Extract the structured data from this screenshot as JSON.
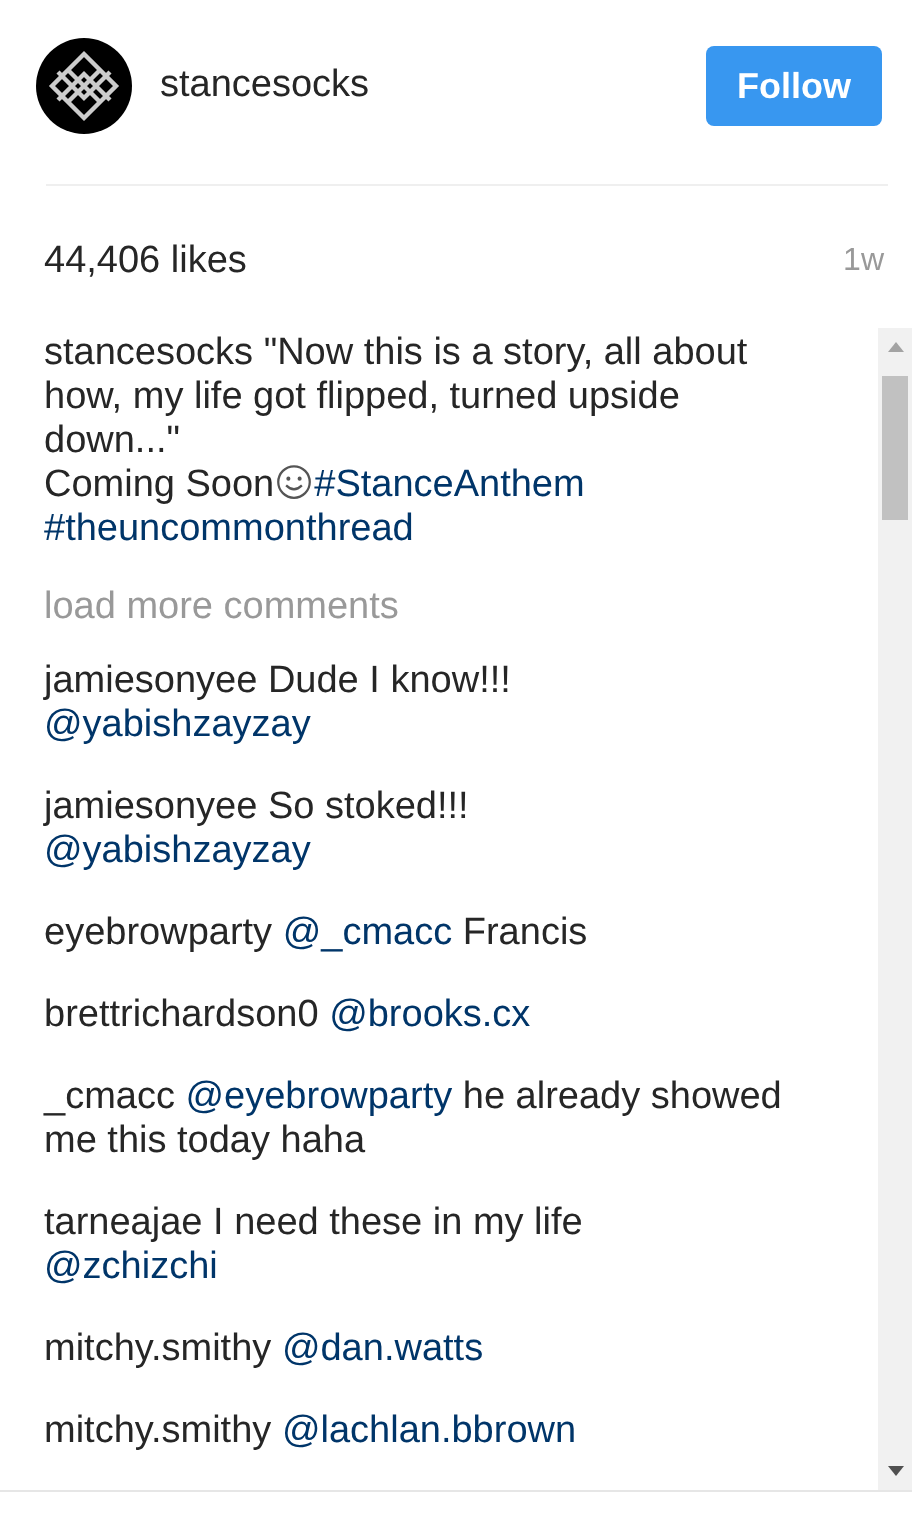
{
  "header": {
    "username": "stancesocks",
    "follow_button": "Follow"
  },
  "likes": "44,406 likes",
  "time": "1w",
  "caption": {
    "user": "stancesocks",
    "parts": [
      {
        "kind": "text",
        "text": "\"Now this is a story, all about how, my life got flipped, turned upside down...\""
      },
      {
        "kind": "break"
      },
      {
        "kind": "text",
        "text": "Coming Soon"
      },
      {
        "kind": "emoji"
      },
      {
        "kind": "tag",
        "text": "#StanceAnthem"
      },
      {
        "kind": "break"
      },
      {
        "kind": "tag",
        "text": "#theuncommonthread"
      }
    ]
  },
  "load_more": "load more comments",
  "comments": [
    {
      "user": "jamiesonyee",
      "parts": [
        {
          "kind": "text",
          "text": "Dude I know!!!"
        },
        {
          "kind": "break"
        },
        {
          "kind": "mention",
          "text": "@yabishzayzay"
        }
      ]
    },
    {
      "user": "jamiesonyee",
      "parts": [
        {
          "kind": "text",
          "text": "So stoked!!!"
        },
        {
          "kind": "break"
        },
        {
          "kind": "mention",
          "text": "@yabishzayzay"
        }
      ]
    },
    {
      "user": "eyebrowparty",
      "parts": [
        {
          "kind": "mention",
          "text": "@_cmacc"
        },
        {
          "kind": "text",
          "text": "Francis"
        }
      ]
    },
    {
      "user": "brettrichardson0",
      "parts": [
        {
          "kind": "mention",
          "text": "@brooks.cx"
        }
      ]
    },
    {
      "user": "_cmacc",
      "parts": [
        {
          "kind": "mention",
          "text": "@eyebrowparty"
        },
        {
          "kind": "text",
          "text": "he already showed me this today haha"
        }
      ]
    },
    {
      "user": "tarneajae",
      "parts": [
        {
          "kind": "text",
          "text": "I need these in my life"
        },
        {
          "kind": "break"
        },
        {
          "kind": "mention",
          "text": "@zchizchi"
        }
      ]
    },
    {
      "user": "mitchy.smithy",
      "parts": [
        {
          "kind": "mention",
          "text": "@dan.watts"
        }
      ]
    },
    {
      "user": "mitchy.smithy",
      "parts": [
        {
          "kind": "mention",
          "text": "@lachlan.bbrown"
        }
      ]
    }
  ]
}
